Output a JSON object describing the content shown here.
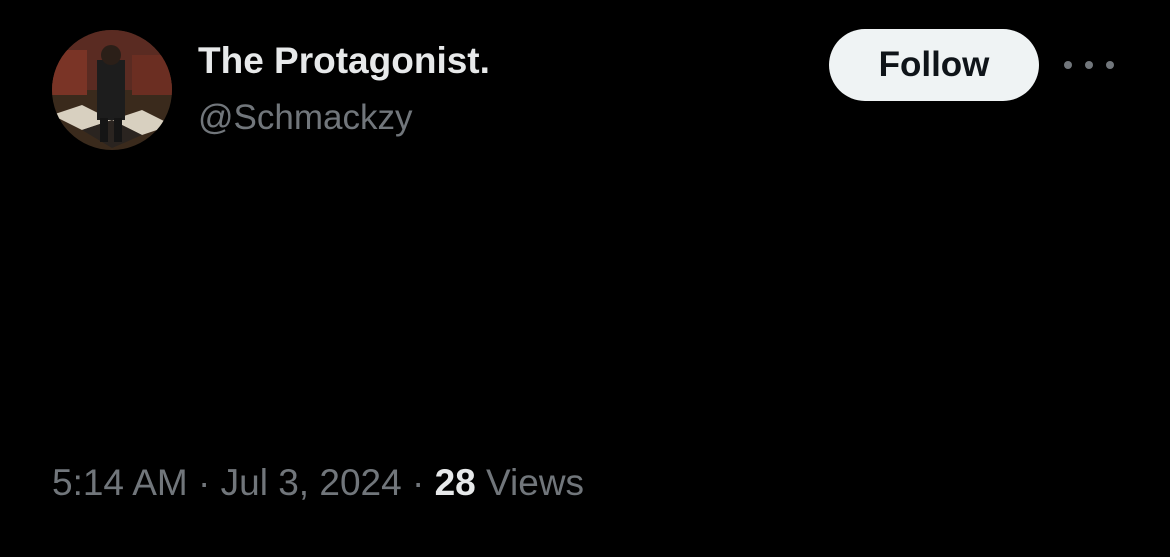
{
  "author": {
    "display_name": "The Protagonist.",
    "handle": "@Schmackzy"
  },
  "actions": {
    "follow_label": "Follow",
    "more_icon": "more-horizontal-icon"
  },
  "tweet": {
    "text": ""
  },
  "meta": {
    "time": "5:14 AM",
    "separator": "·",
    "date": "Jul 3, 2024",
    "views_count": "28",
    "views_label": "Views"
  },
  "colors": {
    "background": "#000000",
    "primary_text": "#e7e9ea",
    "secondary_text": "#71767b",
    "follow_button_bg": "#eff3f4"
  }
}
